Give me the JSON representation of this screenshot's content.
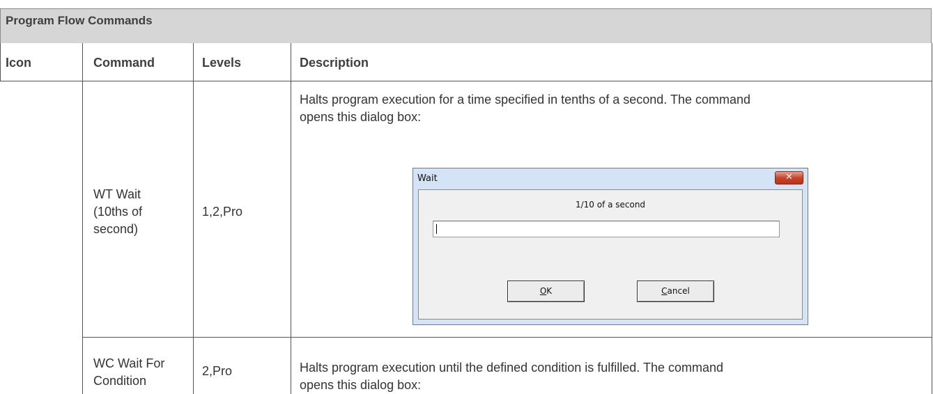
{
  "section": {
    "title": "Program Flow Commands"
  },
  "columns": {
    "icon": "Icon",
    "command": "Command",
    "levels": "Levels",
    "description": "Description"
  },
  "rows": [
    {
      "command_lines": [
        "WT Wait",
        "(10ths of",
        "second)"
      ],
      "levels": "1,2,Pro",
      "description_lines": [
        "Halts program execution for a time specified in tenths of a second. The command",
        "opens this dialog box:"
      ]
    },
    {
      "command_lines": [
        "WC Wait For",
        "Condition"
      ],
      "levels": "2,Pro",
      "description_lines": [
        "Halts program execution until the defined condition is fulfilled. The command",
        "opens this dialog box:"
      ]
    }
  ],
  "dialog": {
    "title": "Wait",
    "close_glyph": "✕",
    "label": "1/10 of a second",
    "input_value": "",
    "ok_mnemonic": "O",
    "ok_rest": "K",
    "cancel_mnemonic": "C",
    "cancel_rest": "ancel"
  }
}
